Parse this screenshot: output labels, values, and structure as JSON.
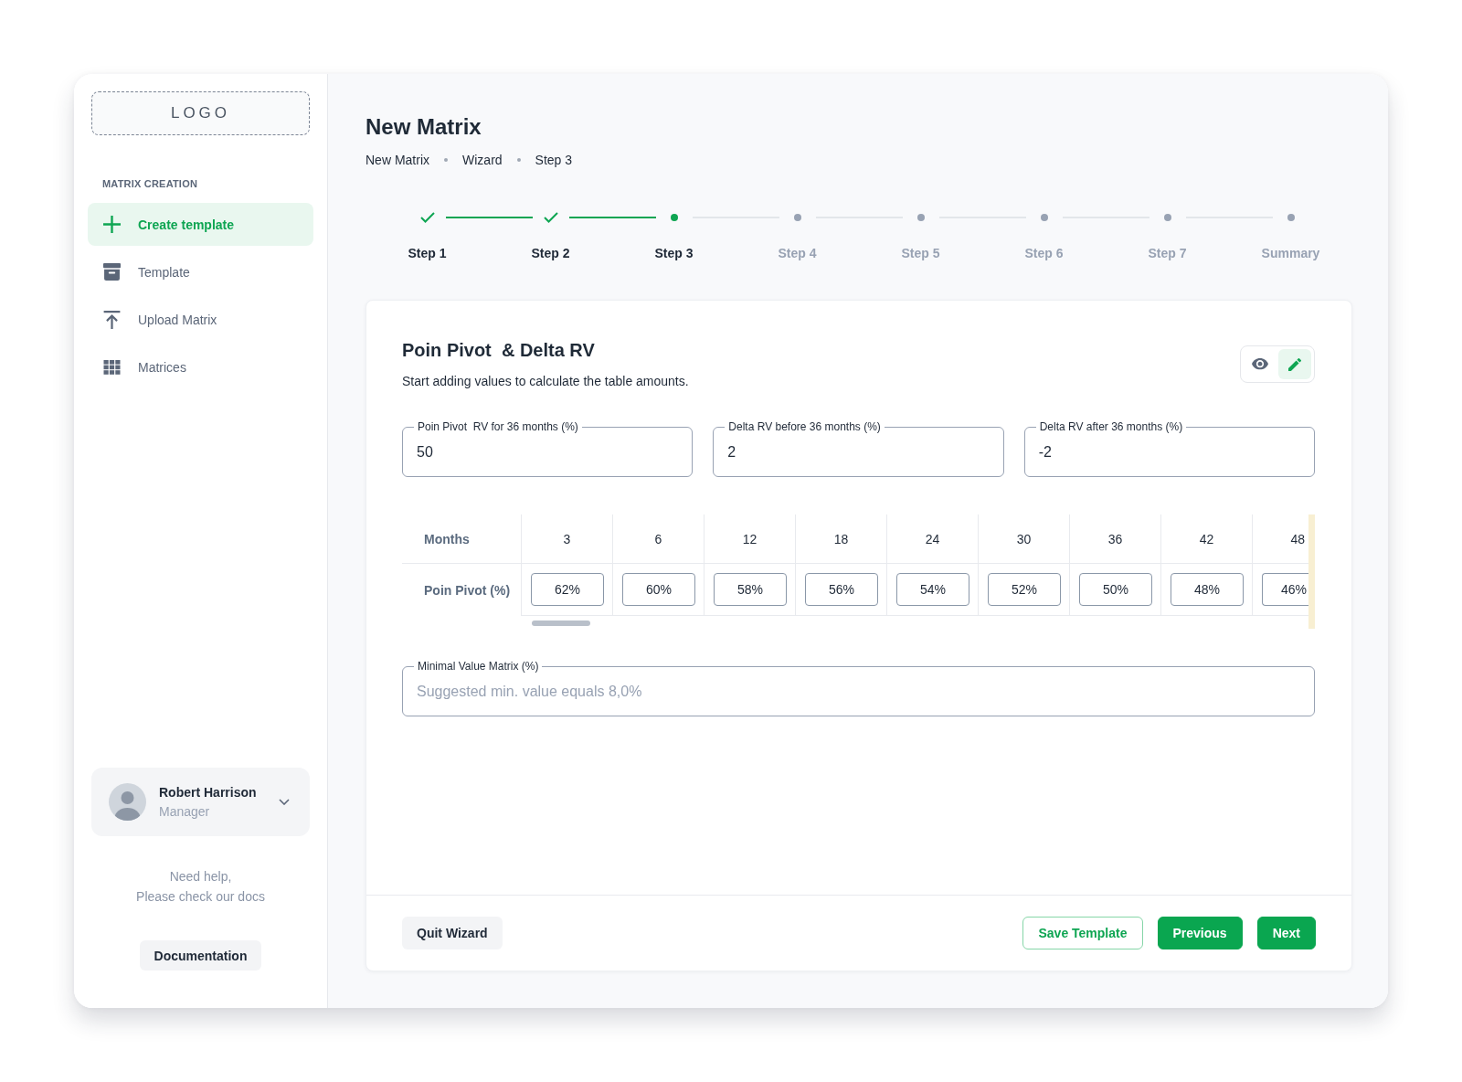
{
  "sidebar": {
    "logo": "LOGO",
    "section_title": "MATRIX CREATION",
    "items": [
      {
        "label": "Create template",
        "kind": "create",
        "selected": true
      },
      {
        "label": "Template",
        "kind": "template",
        "selected": false
      },
      {
        "label": "Upload Matrix",
        "kind": "upload",
        "selected": false
      },
      {
        "label": "Matrices",
        "kind": "matrices",
        "selected": false
      }
    ],
    "user": {
      "name": "Robert Harrison",
      "role": "Manager"
    },
    "help_text": "Need help,\nPlease check our docs",
    "docs_button": "Documentation"
  },
  "page": {
    "title": "New Matrix",
    "breadcrumb": [
      "New Matrix",
      "Wizard",
      "Step 3"
    ]
  },
  "stepper": [
    {
      "label": "Step 1",
      "completed": true,
      "current": false
    },
    {
      "label": "Step 2",
      "completed": true,
      "current": false
    },
    {
      "label": "Step 3",
      "completed": false,
      "current": true
    },
    {
      "label": "Step 4",
      "completed": false,
      "current": false
    },
    {
      "label": "Step 5",
      "completed": false,
      "current": false
    },
    {
      "label": "Step 6",
      "completed": false,
      "current": false
    },
    {
      "label": "Step 7",
      "completed": false,
      "current": false
    },
    {
      "label": "Summary",
      "completed": false,
      "current": false
    }
  ],
  "card": {
    "title": "Poin Pivot  & Delta RV",
    "subtitle": "Start adding values to calculate the table amounts.",
    "view_toggle": [
      {
        "kind": "view",
        "selected": false
      },
      {
        "kind": "edit",
        "selected": true
      }
    ],
    "fields": [
      {
        "label": "Poin Pivot  RV for 36 months (%)",
        "value": "50"
      },
      {
        "label": "Delta RV before 36 months (%)",
        "value": "2"
      },
      {
        "label": "Delta RV after 36 months (%)",
        "value": "-2"
      }
    ],
    "table": {
      "columns": [
        "Months",
        "3",
        "6",
        "12",
        "18",
        "24",
        "30",
        "36",
        "42",
        "48"
      ],
      "rows": [
        {
          "label": "Poin Pivot (%)",
          "values": [
            "62%",
            "60%",
            "58%",
            "56%",
            "54%",
            "52%",
            "50%",
            "48%",
            "46%"
          ]
        }
      ]
    },
    "min_field": {
      "label": "Minimal Value Matrix (%)",
      "placeholder": "Suggested min. value equals 8,0%"
    },
    "footer": {
      "quit": "Quit Wizard",
      "buttons": [
        {
          "label": "Save Template",
          "kind": "outline"
        },
        {
          "label": "Previous",
          "kind": "primary"
        },
        {
          "label": "Next",
          "kind": "primary"
        }
      ]
    }
  }
}
